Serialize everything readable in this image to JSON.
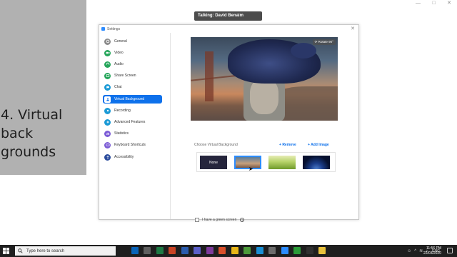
{
  "slide": {
    "title_lines": [
      "4. Virtual",
      "back",
      "grounds"
    ]
  },
  "share_bar": {
    "talking": "Talking: David Benaim"
  },
  "window": {
    "title": "Settings",
    "nav": [
      {
        "label": "General",
        "icon": "gear-icon",
        "color": "#8a8a8a"
      },
      {
        "label": "Video",
        "icon": "video-camera-icon",
        "color": "#26a65b"
      },
      {
        "label": "Audio",
        "icon": "headphones-icon",
        "color": "#26a65b"
      },
      {
        "label": "Share Screen",
        "icon": "share-screen-icon",
        "color": "#26a65b"
      },
      {
        "label": "Chat",
        "icon": "chat-bubble-icon",
        "color": "#1b9ad6"
      },
      {
        "label": "Virtual Background",
        "icon": "person-background-icon",
        "color": "#2d8cff",
        "active": true
      },
      {
        "label": "Recording",
        "icon": "record-icon",
        "color": "#1b9ad6"
      },
      {
        "label": "Advanced Features",
        "icon": "sparkle-icon",
        "color": "#1b9ad6"
      },
      {
        "label": "Statistics",
        "icon": "bar-stats-icon",
        "color": "#7b5bd6"
      },
      {
        "label": "Keyboard Shortcuts",
        "icon": "keyboard-icon",
        "color": "#7b5bd6"
      },
      {
        "label": "Accessibility",
        "icon": "accessibility-icon",
        "color": "#2d4e9e"
      }
    ],
    "rotate_label": "Rotate 90°",
    "choose_label": "Choose Virtual Background",
    "remove_label": "Remove",
    "add_label": "Add Image",
    "thumbnails": {
      "none_label": "None"
    },
    "green_screen_label": "I have a green screen"
  },
  "taskbar": {
    "search_placeholder": "Type here to search",
    "apps": [
      {
        "icon": "cortana-icon",
        "color": "#1f1f1f"
      },
      {
        "icon": "outlook-icon",
        "color": "#0a64b8"
      },
      {
        "icon": "task-view-icon",
        "color": "#5f5f5f"
      },
      {
        "icon": "excel-icon",
        "color": "#1d7a44"
      },
      {
        "icon": "powerpoint-icon",
        "color": "#c94324"
      },
      {
        "icon": "word-icon",
        "color": "#2b5cad"
      },
      {
        "icon": "teams-icon",
        "color": "#5b5fc7"
      },
      {
        "icon": "onenote-icon",
        "color": "#7d3b9b"
      },
      {
        "icon": "snagit-icon",
        "color": "#d94f2a"
      },
      {
        "icon": "chrome-icon",
        "color": "#e7b518"
      },
      {
        "icon": "camtasia-icon",
        "color": "#4d9a3a"
      },
      {
        "icon": "edge-icon",
        "color": "#1a8fd4"
      },
      {
        "icon": "settings-icon",
        "color": "#6c6c6c"
      },
      {
        "icon": "zoom-icon",
        "color": "#2d8cff"
      },
      {
        "icon": "green-app-icon",
        "color": "#2b9b38"
      },
      {
        "icon": "terminal-icon",
        "color": "#303030"
      },
      {
        "icon": "file-explorer-icon",
        "color": "#e8c13c"
      }
    ],
    "language": "ENG",
    "time": "11:56 PM",
    "date": "22/03/2020"
  }
}
